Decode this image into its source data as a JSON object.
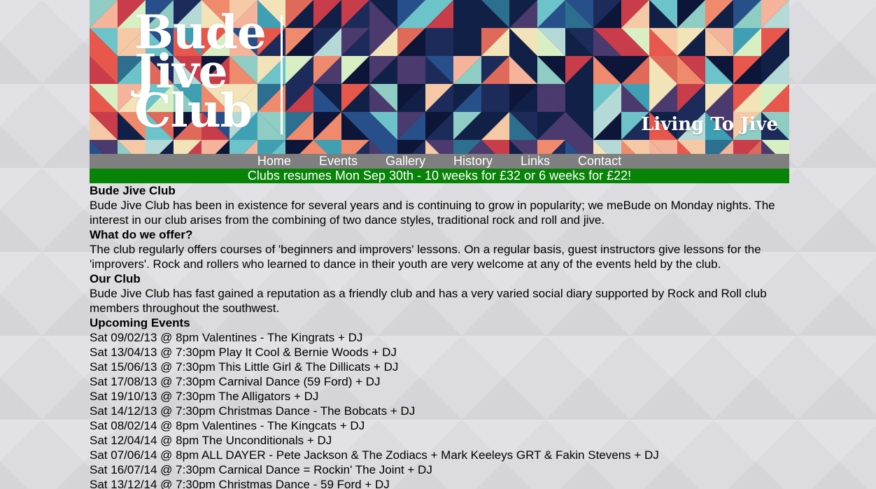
{
  "banner": {
    "logo_line_1": "Bude",
    "logo_line_2": "Jive",
    "logo_line_3": "Club",
    "tagline": "Living To Jive"
  },
  "nav": {
    "items": [
      {
        "label": "Home"
      },
      {
        "label": "Events"
      },
      {
        "label": "Gallery"
      },
      {
        "label": "History"
      },
      {
        "label": "Links"
      },
      {
        "label": "Contact"
      }
    ]
  },
  "announcement": "Clubs resumes Mon Sep 30th - 10 weeks for £32 or 6 weeks for £22!",
  "sections": [
    {
      "heading": "Bude Jive Club",
      "body": "Bude Jive Club has been in existence for several years and is continuing to grow in popularity; we meBude on Monday nights. The interest in our club arises from the combining of two dance styles, traditional rock and roll and jive."
    },
    {
      "heading": "What do we offer?",
      "body": "The club regularly offers courses of 'beginners and improvers' lessons. On a regular basis, guest instructors give lessons for the 'improvers'. Rock and rollers who learned to dance in their youth are very welcome at any of the events held by the club."
    },
    {
      "heading": "Our Club",
      "body": "Bude Jive Club has fast gained a reputation as a friendly club and has a very varied social diary supported by Rock and Roll club members throughout the southwest."
    }
  ],
  "events": {
    "heading": "Upcoming Events",
    "items": [
      "Sat 09/02/13 @ 8pm Valentines - The Kingrats + DJ",
      "Sat 13/04/13 @ 7:30pm Play It Cool & Bernie Woods + DJ",
      "Sat 15/06/13 @ 7:30pm This Little Girl & The Dillicats + DJ",
      "Sat 17/08/13 @ 7:30pm Carnival Dance (59 Ford) + DJ",
      "Sat 19/10/13 @ 7:30pm The Alligators + DJ",
      "Sat 14/12/13 @ 7:30pm Christmas Dance - The Bobcats + DJ",
      "Sat 08/02/14 @ 8pm Valentines - The Kingcats + DJ",
      "Sat 12/04/14 @ 8pm The Unconditionals + DJ",
      "Sat 07/06/14 @ 8pm ALL DAYER - Pete Jackson & The Zodiacs + Mark Keeleys GRT & Fakin Stevens + DJ",
      "Sat 16/07/14 @ 7:30pm Carnical Dance = Rockin' The Joint + DJ",
      "Sat 13/12/14 @ 7:30pm Christmas Dance - 59 Ford + DJ"
    ]
  },
  "colors": {
    "nav_background": "#7f7f7f",
    "announcement_background": "#078307",
    "page_background": "#dcdce0"
  }
}
